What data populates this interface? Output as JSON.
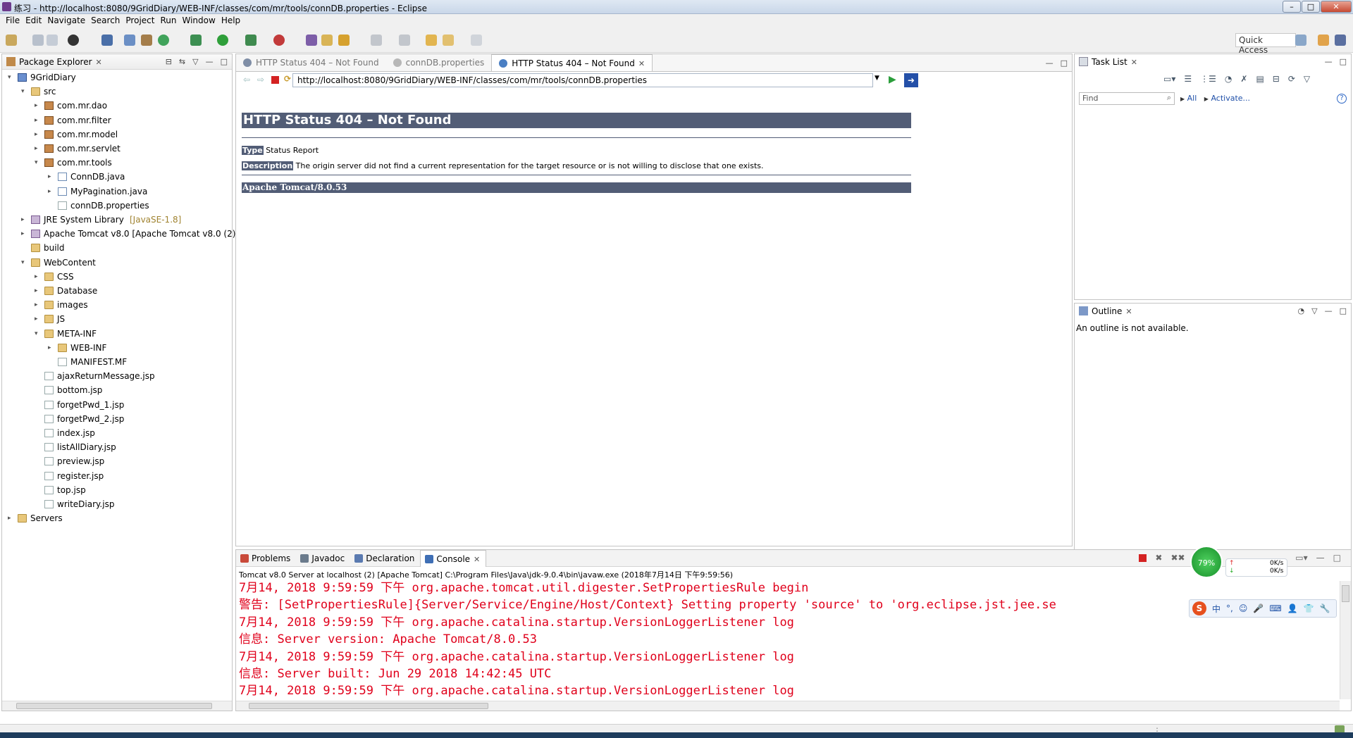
{
  "window": {
    "title": "练习 - http://localhost:8080/9GridDiary/WEB-INF/classes/com/mr/tools/connDB.properties - Eclipse"
  },
  "menu": [
    "File",
    "Edit",
    "Navigate",
    "Search",
    "Project",
    "Run",
    "Window",
    "Help"
  ],
  "toolbar": {
    "quick_access": "Quick Access"
  },
  "package_explorer": {
    "title": "Package Explorer",
    "tree": [
      {
        "label": "9GridDiary",
        "depth": 0,
        "twisty": "▾",
        "icon": "proj"
      },
      {
        "label": "src",
        "depth": 1,
        "twisty": "▾",
        "icon": "folder"
      },
      {
        "label": "com.mr.dao",
        "depth": 2,
        "twisty": "▸",
        "icon": "pkg"
      },
      {
        "label": "com.mr.filter",
        "depth": 2,
        "twisty": "▸",
        "icon": "pkg"
      },
      {
        "label": "com.mr.model",
        "depth": 2,
        "twisty": "▸",
        "icon": "pkg"
      },
      {
        "label": "com.mr.servlet",
        "depth": 2,
        "twisty": "▸",
        "icon": "pkg"
      },
      {
        "label": "com.mr.tools",
        "depth": 2,
        "twisty": "▾",
        "icon": "pkg"
      },
      {
        "label": "ConnDB.java",
        "depth": 3,
        "twisty": "▸",
        "icon": "java"
      },
      {
        "label": "MyPagination.java",
        "depth": 3,
        "twisty": "▸",
        "icon": "java"
      },
      {
        "label": "connDB.properties",
        "depth": 3,
        "twisty": "",
        "icon": "jsp"
      },
      {
        "label": "JRE System Library",
        "extra": "[JavaSE-1.8]",
        "depth": 1,
        "twisty": "▸",
        "icon": "lib"
      },
      {
        "label": "Apache Tomcat v8.0 [Apache Tomcat v8.0 (2)]",
        "depth": 1,
        "twisty": "▸",
        "icon": "lib"
      },
      {
        "label": "build",
        "depth": 1,
        "twisty": "",
        "icon": "folder"
      },
      {
        "label": "WebContent",
        "depth": 1,
        "twisty": "▾",
        "icon": "folder"
      },
      {
        "label": "CSS",
        "depth": 2,
        "twisty": "▸",
        "icon": "folder"
      },
      {
        "label": "Database",
        "depth": 2,
        "twisty": "▸",
        "icon": "folder"
      },
      {
        "label": "images",
        "depth": 2,
        "twisty": "▸",
        "icon": "folder"
      },
      {
        "label": "JS",
        "depth": 2,
        "twisty": "▸",
        "icon": "folder"
      },
      {
        "label": "META-INF",
        "depth": 2,
        "twisty": "▾",
        "icon": "folder"
      },
      {
        "label": "WEB-INF",
        "depth": 3,
        "twisty": "▸",
        "icon": "folder"
      },
      {
        "label": "MANIFEST.MF",
        "depth": 3,
        "twisty": "",
        "icon": "jsp"
      },
      {
        "label": "ajaxReturnMessage.jsp",
        "depth": 2,
        "twisty": "",
        "icon": "jsp"
      },
      {
        "label": "bottom.jsp",
        "depth": 2,
        "twisty": "",
        "icon": "jsp"
      },
      {
        "label": "forgetPwd_1.jsp",
        "depth": 2,
        "twisty": "",
        "icon": "jsp"
      },
      {
        "label": "forgetPwd_2.jsp",
        "depth": 2,
        "twisty": "",
        "icon": "jsp"
      },
      {
        "label": "index.jsp",
        "depth": 2,
        "twisty": "",
        "icon": "jsp"
      },
      {
        "label": "listAllDiary.jsp",
        "depth": 2,
        "twisty": "",
        "icon": "jsp"
      },
      {
        "label": "preview.jsp",
        "depth": 2,
        "twisty": "",
        "icon": "jsp"
      },
      {
        "label": "register.jsp",
        "depth": 2,
        "twisty": "",
        "icon": "jsp"
      },
      {
        "label": "top.jsp",
        "depth": 2,
        "twisty": "",
        "icon": "jsp"
      },
      {
        "label": "writeDiary.jsp",
        "depth": 2,
        "twisty": "",
        "icon": "jsp"
      },
      {
        "label": "Servers",
        "depth": 0,
        "twisty": "▸",
        "icon": "folder"
      }
    ]
  },
  "editor": {
    "tabs": [
      {
        "label": "HTTP Status 404 – Not Found",
        "active": false
      },
      {
        "label": "connDB.properties",
        "active": false
      },
      {
        "label": "HTTP Status 404 – Not Found",
        "active": true
      }
    ],
    "url": "http://localhost:8080/9GridDiary/WEB-INF/classes/com/mr/tools/connDB.properties",
    "page": {
      "heading": "HTTP Status 404 – Not Found",
      "type_label": "Type",
      "type_value": " Status Report",
      "desc_label": "Description",
      "desc_value": " The origin server did not find a current representation for the target resource or is not willing to disclose that one exists.",
      "footer": "Apache Tomcat/8.0.53"
    }
  },
  "task_list": {
    "title": "Task List",
    "find_placeholder": "Find",
    "all": "All",
    "activate": "Activate..."
  },
  "outline": {
    "title": "Outline",
    "message": "An outline is not available."
  },
  "console": {
    "tabs": [
      {
        "label": "Problems",
        "active": false
      },
      {
        "label": "Javadoc",
        "active": false
      },
      {
        "label": "Declaration",
        "active": false
      },
      {
        "label": "Console",
        "active": true
      }
    ],
    "header": "Tomcat v8.0 Server at localhost (2) [Apache Tomcat] C:\\Program Files\\Java\\jdk-9.0.4\\bin\\javaw.exe (2018年7月14日 下午9:59:56)",
    "lines": [
      "7月14, 2018 9:59:59 下午 org.apache.tomcat.util.digester.SetPropertiesRule begin",
      "警告: [SetPropertiesRule]{Server/Service/Engine/Host/Context} Setting property 'source' to 'org.eclipse.jst.jee.se",
      "7月14, 2018 9:59:59 下午 org.apache.catalina.startup.VersionLoggerListener log",
      "信息: Server version:        Apache Tomcat/8.0.53",
      "7月14, 2018 9:59:59 下午 org.apache.catalina.startup.VersionLoggerListener log",
      "信息: Server built:          Jun 29 2018 14:42:45 UTC",
      "7月14, 2018 9:59:59 下午 org.apache.catalina.startup.VersionLoggerListener log"
    ],
    "net_badge": {
      "percent": "79%",
      "up": "0K/s",
      "down": "0K/s"
    }
  }
}
